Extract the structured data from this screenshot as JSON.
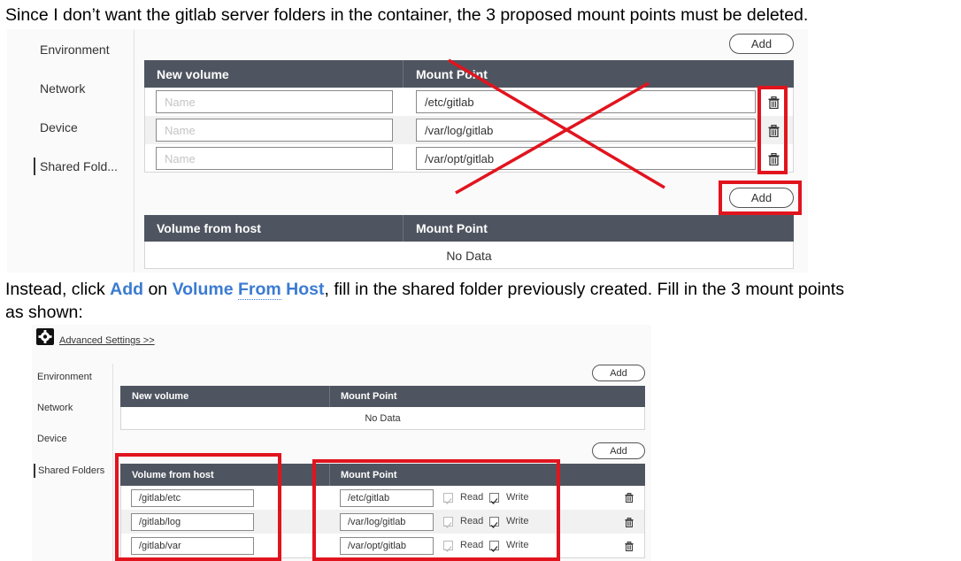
{
  "captions": {
    "line1": "Since I don’t want the gitlab server folders in the container, the 3 proposed mount points must be deleted.",
    "line2_pre": "Instead, click ",
    "line2_add": "Add",
    "line2_mid": " on ",
    "line2_vol": "Volume",
    "line2_from": "From",
    "line2_host": "Host",
    "line2_post": ", fill in the shared folder previously created. Fill in the 3 mount points",
    "line3": "as shown:"
  },
  "panel1": {
    "nav": [
      "Environment",
      "Network",
      "Device",
      "Shared Fold..."
    ],
    "add_label": "Add",
    "new_volume_header": "New volume",
    "mount_point_header": "Mount Point",
    "rows": [
      {
        "name_placeholder": "Name",
        "mount": "/etc/gitlab"
      },
      {
        "name_placeholder": "Name",
        "mount": "/var/log/gitlab"
      },
      {
        "name_placeholder": "Name",
        "mount": "/var/opt/gitlab"
      }
    ],
    "add2_label": "Add",
    "host_header": "Volume from host",
    "host_mount_header": "Mount Point",
    "no_data": "No Data"
  },
  "panel2": {
    "advanced_link": "Advanced Settings >>",
    "nav": [
      "Environment",
      "Network",
      "Device",
      "Shared Folders"
    ],
    "add_label": "Add",
    "new_volume_header": "New volume",
    "mount_point_header": "Mount Point",
    "no_data": "No Data",
    "add2_label": "Add",
    "host_header": "Volume from host",
    "host_mount_header": "Mount Point",
    "read_label": "Read",
    "write_label": "Write",
    "rows": [
      {
        "host": "/gitlab/etc",
        "mount": "/etc/gitlab"
      },
      {
        "host": "/gitlab/log",
        "mount": "/var/log/gitlab"
      },
      {
        "host": "/gitlab/var",
        "mount": "/var/opt/gitlab"
      }
    ]
  },
  "colors": {
    "highlight": "#3b7bd1",
    "annotation_red": "#e1141e",
    "table_header": "#4f5560"
  }
}
